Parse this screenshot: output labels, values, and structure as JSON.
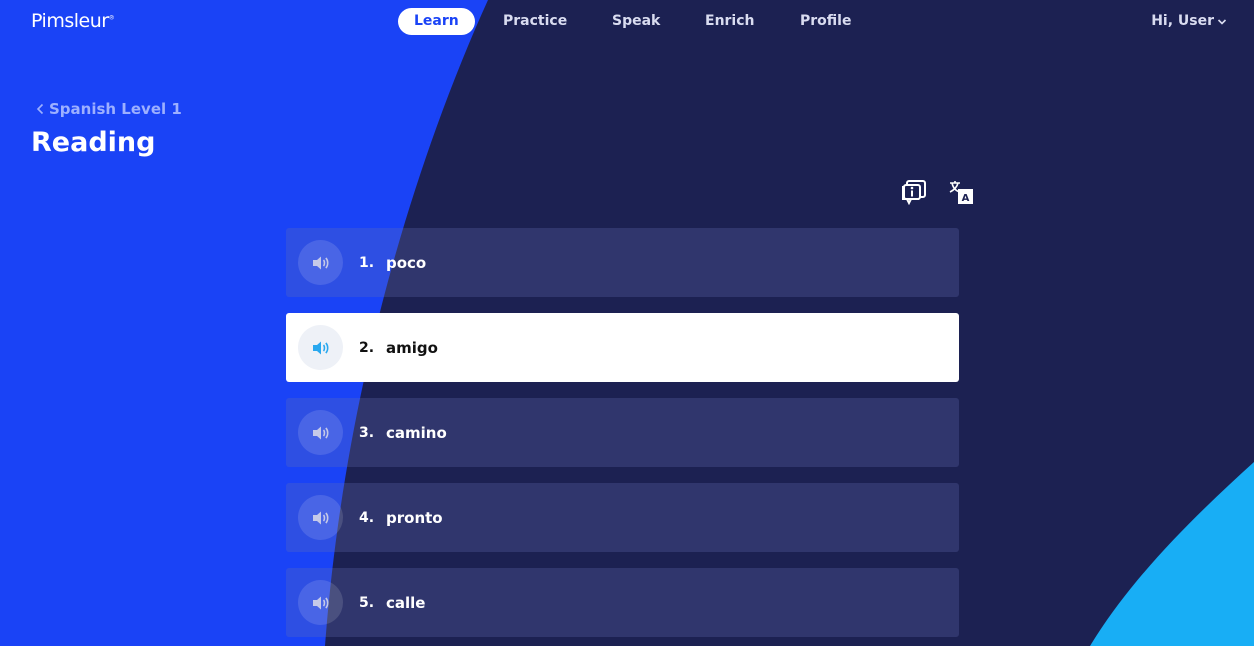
{
  "app": {
    "logo": "Pimsleur",
    "logo_mark": "®"
  },
  "nav": {
    "items": [
      {
        "label": "Learn",
        "active": true
      },
      {
        "label": "Practice",
        "active": false
      },
      {
        "label": "Speak",
        "active": false
      },
      {
        "label": "Enrich",
        "active": false
      },
      {
        "label": "Profile",
        "active": false
      }
    ]
  },
  "user": {
    "greeting": "Hi, User"
  },
  "breadcrumb": {
    "label": "Spanish Level 1"
  },
  "page": {
    "title": "Reading"
  },
  "tools": {
    "info_icon": "info-bubble-icon",
    "translate_icon": "translate-icon"
  },
  "words": [
    {
      "number": "1.",
      "text": "poco",
      "selected": false
    },
    {
      "number": "2.",
      "text": "amigo",
      "selected": true
    },
    {
      "number": "3.",
      "text": "camino",
      "selected": false
    },
    {
      "number": "4.",
      "text": "pronto",
      "selected": false
    },
    {
      "number": "5.",
      "text": "calle",
      "selected": false
    }
  ],
  "colors": {
    "primary_blue": "#1a43f6",
    "dark_navy": "#1c2152",
    "accent_cyan": "#18aef5",
    "row_bg": "#363a65",
    "selected_row_bg": "#ffffff",
    "audio_icon_active": "#29a8ef"
  }
}
